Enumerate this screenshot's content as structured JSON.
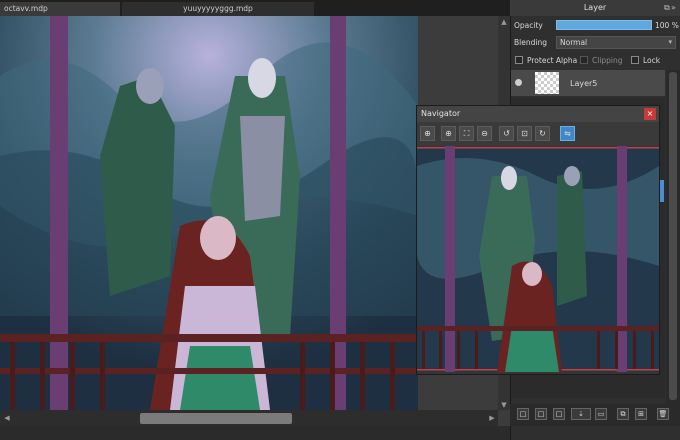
{
  "tabs": [
    {
      "label": "octavv.mdp"
    },
    {
      "label": "yuuyyyyyggg.mdp"
    }
  ],
  "layer_panel": {
    "title": "Layer",
    "opacity_label": "Opacity",
    "opacity_value": "100 %",
    "opacity_fraction": 1.0,
    "blending_label": "Blending",
    "blending_value": "Normal",
    "protect_alpha_label": "Protect Alpha",
    "clipping_label": "Clipping",
    "lock_label": "Lock",
    "layers": [
      {
        "name": "Layer5",
        "visible": true
      }
    ]
  },
  "navigator": {
    "title": "Navigator",
    "close_glyph": "×",
    "buttons": [
      {
        "icon": "zoom-in-icon",
        "glyph": "⊕"
      },
      {
        "icon": "zoom-in-icon",
        "glyph": "⊕"
      },
      {
        "icon": "fit-icon",
        "glyph": "⛶"
      },
      {
        "icon": "zoom-out-icon",
        "glyph": "⊖"
      },
      {
        "icon": "rotate-left-icon",
        "glyph": "↺"
      },
      {
        "icon": "reset-icon",
        "glyph": "⊡"
      },
      {
        "icon": "rotate-right-icon",
        "glyph": "↻"
      },
      {
        "icon": "flip-icon",
        "glyph": "⇋"
      }
    ]
  },
  "layer_toolbar": [
    {
      "icon": "new-layer-icon",
      "glyph": "□"
    },
    {
      "icon": "new-layer-icon",
      "glyph": "□"
    },
    {
      "icon": "new-layer-icon",
      "glyph": "□"
    },
    {
      "icon": "add-layer-dropdown-icon",
      "glyph": "⇣"
    },
    {
      "icon": "folder-icon",
      "glyph": "▭"
    },
    {
      "icon": "duplicate-icon",
      "glyph": "⧉"
    },
    {
      "icon": "merge-icon",
      "glyph": "⊞"
    },
    {
      "icon": "trash-icon",
      "glyph": "🗑"
    }
  ],
  "colors": {
    "accent": "#5fa7dd",
    "close": "#c63a3a"
  }
}
